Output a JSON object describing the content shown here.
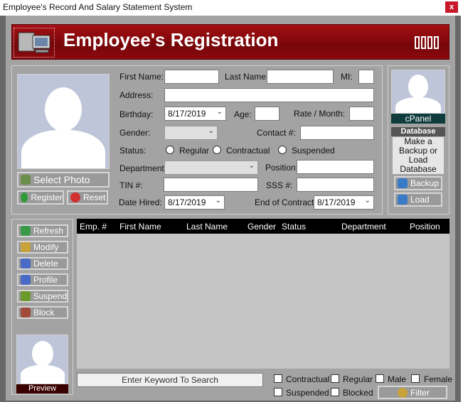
{
  "window": {
    "title": "Employee's Record And Salary Statement System",
    "close_label": "x"
  },
  "banner": {
    "title": "Employee's Registration"
  },
  "form": {
    "first_name_label": "First Name:",
    "last_name_label": "Last Name:",
    "mi_label": "MI:",
    "address_label": "Address:",
    "birthday_label": "Birthday:",
    "birthday_value": "8/17/2019",
    "age_label": "Age:",
    "rate_label": "Rate / Month:",
    "gender_label": "Gender:",
    "contact_label": "Contact #:",
    "status_label": "Status:",
    "status_options": [
      "Regular",
      "Contractual",
      "Suspended"
    ],
    "department_label": "Department:",
    "position_label": "Position:",
    "tin_label": "TIN #:",
    "sss_label": "SSS #:",
    "date_hired_label": "Date Hired:",
    "date_hired_value": "8/17/2019",
    "end_contract_label": "End of Contract:",
    "end_contract_value": "8/17/2019"
  },
  "photo_panel": {
    "select_photo": "Select Photo",
    "register": "Register",
    "reset": "Reset"
  },
  "cpanel": {
    "label": "cPanel",
    "database_header": "Database",
    "database_text": "Make a Backup or Load Database",
    "backup": "Backup",
    "load": "Load"
  },
  "actions": {
    "refresh": "Refresh",
    "modify": "Modify",
    "delete": "Delete",
    "profile": "Profile",
    "suspend": "Suspend",
    "block": "Block",
    "preview": "Preview"
  },
  "table": {
    "columns": [
      "Emp. #",
      "First Name",
      "Last Name",
      "Gender",
      "Status",
      "Department",
      "Position"
    ]
  },
  "search": {
    "placeholder": "Enter Keyword To Search"
  },
  "filters": {
    "contractual": "Contractual",
    "regular": "Regular",
    "male": "Male",
    "female": "Female",
    "suspended": "Suspended",
    "blocked": "Blocked",
    "filter_button": "Filter"
  },
  "colors": {
    "banner": "#8b0a0f",
    "frame": "#a3a3a3",
    "grid_header": "#000000",
    "cpanel_label": "#0f3d3d"
  }
}
